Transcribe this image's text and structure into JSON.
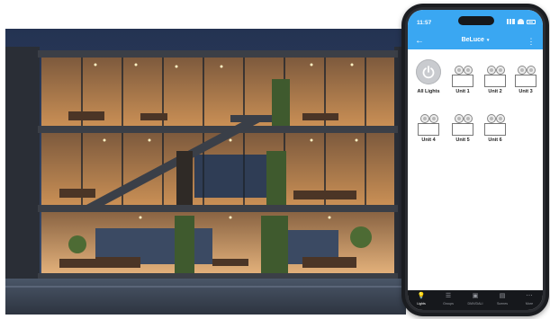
{
  "phone": {
    "status_time": "11:57",
    "app_title": "BeLuce",
    "title_caret": "▾",
    "back_glyph": "←",
    "more_glyph": "⋮",
    "tiles": [
      {
        "label": "All Lights",
        "icon": "power-icon"
      },
      {
        "label": "Unit 1",
        "icon": "light-unit-icon"
      },
      {
        "label": "Unit 2",
        "icon": "light-unit-icon"
      },
      {
        "label": "Unit 3",
        "icon": "light-unit-icon"
      },
      {
        "label": "Unit 4",
        "icon": "light-unit-icon"
      },
      {
        "label": "Unit 5",
        "icon": "light-unit-icon"
      },
      {
        "label": "Unit 6",
        "icon": "light-unit-icon"
      }
    ],
    "tabs": [
      {
        "label": "Lights",
        "icon": "bulb-icon",
        "glyph": "💡",
        "active": true
      },
      {
        "label": "Groups",
        "icon": "groups-icon",
        "glyph": "☰",
        "active": false
      },
      {
        "label": "DMX/DALI",
        "icon": "dmx-icon",
        "glyph": "▣",
        "active": false
      },
      {
        "label": "Scenes",
        "icon": "scenes-icon",
        "glyph": "▤",
        "active": false
      },
      {
        "label": "More",
        "icon": "share-icon",
        "glyph": "⋯",
        "active": false
      }
    ]
  },
  "colors": {
    "accent": "#3aa7f2",
    "tabbar": "#16181c",
    "power_button": "#c9cbcf",
    "warm_light": "#e8a25a",
    "night_sky": "#2b3a57"
  },
  "illustration": {
    "icon": "illuminated-building-cross-section"
  }
}
